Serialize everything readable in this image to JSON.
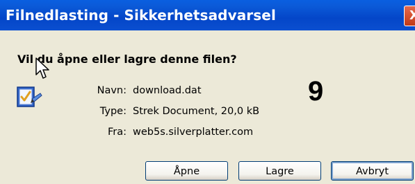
{
  "dialog": {
    "title": "Filnedlasting - Sikkerhetsadvarsel",
    "close_glyph": "X",
    "question": "Vil du åpne eller lagre denne filen?",
    "file_icon": "file-download-icon",
    "cursor_icon": "mouse-pointer-icon",
    "fields": [
      {
        "label": "Navn:",
        "value": "download.dat"
      },
      {
        "label": "Type:",
        "value": "Strek Document, 20,0 kB"
      },
      {
        "label": "Fra:",
        "value": "web5s.silverplatter.com"
      }
    ],
    "overlay_number": "9",
    "buttons": {
      "open": "Åpne",
      "save": "Lagre",
      "cancel": "Avbryt"
    }
  },
  "colors": {
    "titlebar": "#0a5fe0",
    "dialog_bg": "#ece9d8",
    "close_button": "#c23a16",
    "button_border": "#003c74"
  }
}
